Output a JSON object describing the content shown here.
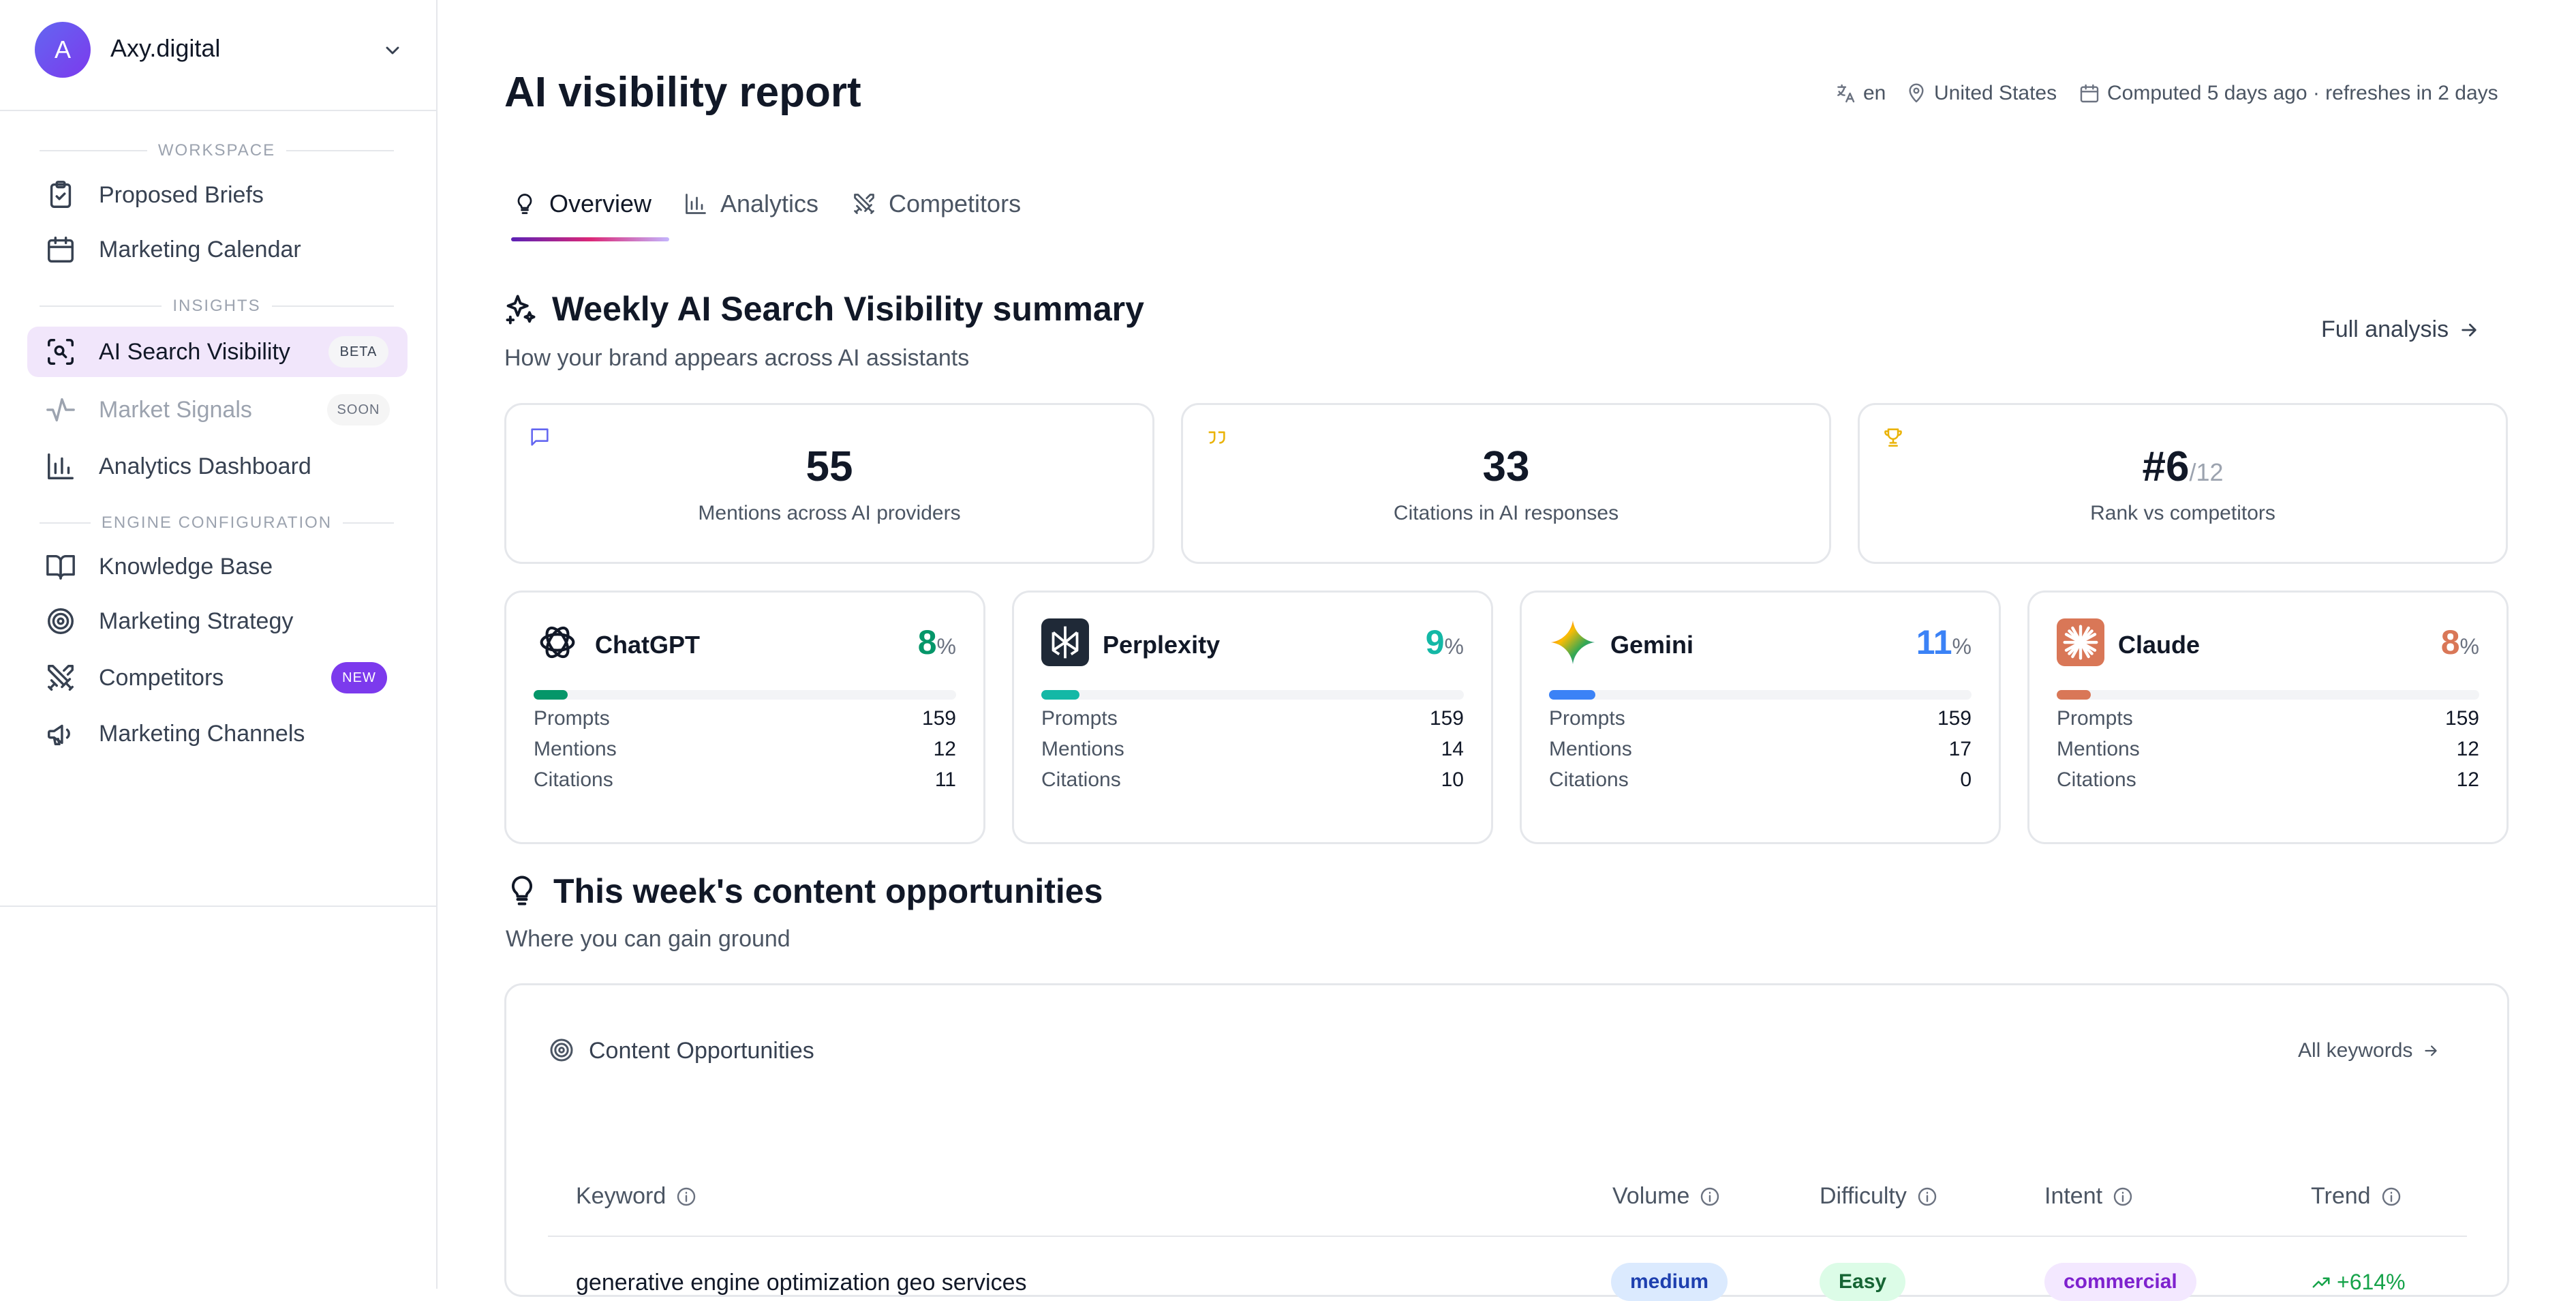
{
  "org": {
    "initial": "A",
    "name": "Axy.digital"
  },
  "sidebar": {
    "sections": {
      "workspace": "WORKSPACE",
      "insights": "INSIGHTS",
      "engine": "ENGINE CONFIGURATION"
    },
    "items": [
      {
        "label": "Proposed Briefs",
        "icon": "clipboard-check-icon"
      },
      {
        "label": "Marketing Calendar",
        "icon": "calendar-icon"
      },
      {
        "label": "AI Search Visibility",
        "icon": "scan-search-icon",
        "badge": "BETA",
        "active": true
      },
      {
        "label": "Market Signals",
        "icon": "activity-icon",
        "badge": "SOON",
        "muted": true
      },
      {
        "label": "Analytics Dashboard",
        "icon": "bar-chart-icon"
      },
      {
        "label": "Knowledge Base",
        "icon": "book-open-icon"
      },
      {
        "label": "Marketing Strategy",
        "icon": "target-icon"
      },
      {
        "label": "Competitors",
        "icon": "swords-icon",
        "badge": "NEW"
      },
      {
        "label": "Marketing Channels",
        "icon": "megaphone-icon"
      }
    ]
  },
  "header": {
    "title": "AI visibility report",
    "language": "en",
    "location": "United States",
    "computed": "Computed 5 days ago · refreshes in 2 days"
  },
  "tabs": [
    {
      "label": "Overview",
      "icon": "lightbulb-icon",
      "active": true
    },
    {
      "label": "Analytics",
      "icon": "bar-chart-icon"
    },
    {
      "label": "Competitors",
      "icon": "swords-icon"
    }
  ],
  "summary": {
    "title": "Weekly AI Search Visibility summary",
    "subtitle": "How your brand appears across AI assistants",
    "full_analysis": "Full analysis",
    "stats": [
      {
        "value": "55",
        "label": "Mentions across AI providers",
        "icon": "message-square-icon",
        "color": "#6366f1"
      },
      {
        "value": "33",
        "label": "Citations in AI responses",
        "icon": "quote-icon",
        "color": "#eab308"
      },
      {
        "value": "#6",
        "denominator": "/12",
        "label": "Rank vs competitors",
        "icon": "trophy-icon",
        "color": "#eab308"
      }
    ]
  },
  "providers": {
    "row_labels": {
      "prompts": "Prompts",
      "mentions": "Mentions",
      "citations": "Citations"
    },
    "unit": "%",
    "items": [
      {
        "name": "ChatGPT",
        "pct": "8",
        "fill": 0.08,
        "color": "#059669",
        "prompts": "159",
        "mentions": "12",
        "citations": "11",
        "icon": "openai-logo-icon"
      },
      {
        "name": "Perplexity",
        "pct": "9",
        "fill": 0.09,
        "color": "#14b8a6",
        "prompts": "159",
        "mentions": "14",
        "citations": "10",
        "icon": "perplexity-logo-icon"
      },
      {
        "name": "Gemini",
        "pct": "11",
        "fill": 0.11,
        "color": "#3b82f6",
        "prompts": "159",
        "mentions": "17",
        "citations": "0",
        "icon": "gemini-logo-icon"
      },
      {
        "name": "Claude",
        "pct": "8",
        "fill": 0.08,
        "color": "#d97757",
        "prompts": "159",
        "mentions": "12",
        "citations": "12",
        "icon": "claude-logo-icon"
      }
    ]
  },
  "opportunities": {
    "title": "This week's content opportunities",
    "subtitle": "Where you can gain ground",
    "card_title": "Content Opportunities",
    "all_keywords": "All keywords",
    "columns": [
      "Keyword",
      "Volume",
      "Difficulty",
      "Intent",
      "Trend"
    ],
    "rows": [
      {
        "keyword": "generative engine optimization geo services",
        "volume": "medium",
        "difficulty": "Easy",
        "intent": "commercial",
        "trend": "+614%"
      }
    ]
  }
}
